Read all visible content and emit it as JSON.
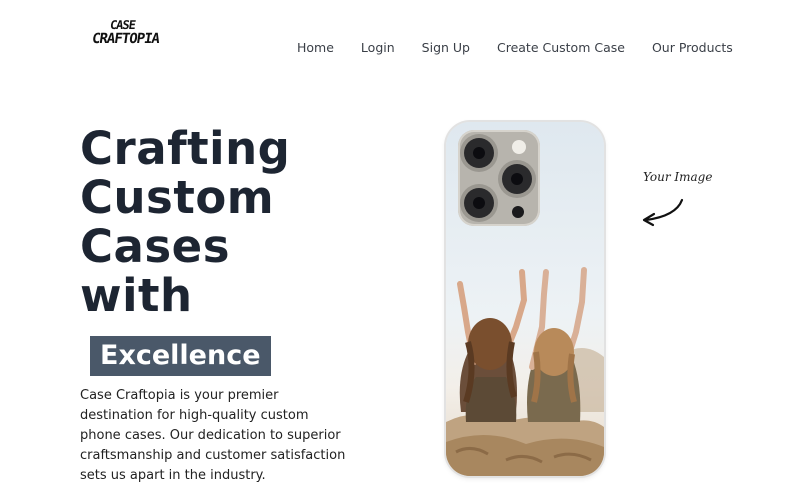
{
  "brand": {
    "line1": "CASE",
    "line2": "CRAFTOPIA"
  },
  "nav": {
    "items": [
      {
        "label": "Home"
      },
      {
        "label": "Login"
      },
      {
        "label": "Sign Up"
      },
      {
        "label": "Create Custom Case"
      },
      {
        "label": "Our Products"
      }
    ]
  },
  "hero": {
    "title_lines": [
      "Crafting",
      "Custom",
      "Cases",
      "with"
    ],
    "highlight": "Excellence",
    "description": "Case Craftopia is your premier destination for high-quality custom phone cases. Our dedication to superior craftsmanship and customer satisfaction sets us apart in the industry."
  },
  "annotation": {
    "text": "Your Image"
  },
  "colors": {
    "title": "#1d2532",
    "badge_bg": "#4a5869",
    "badge_text": "#ffffff",
    "nav_text": "#3a3f47"
  },
  "icons": {
    "annotation_arrow": "curved-arrow-icon"
  }
}
